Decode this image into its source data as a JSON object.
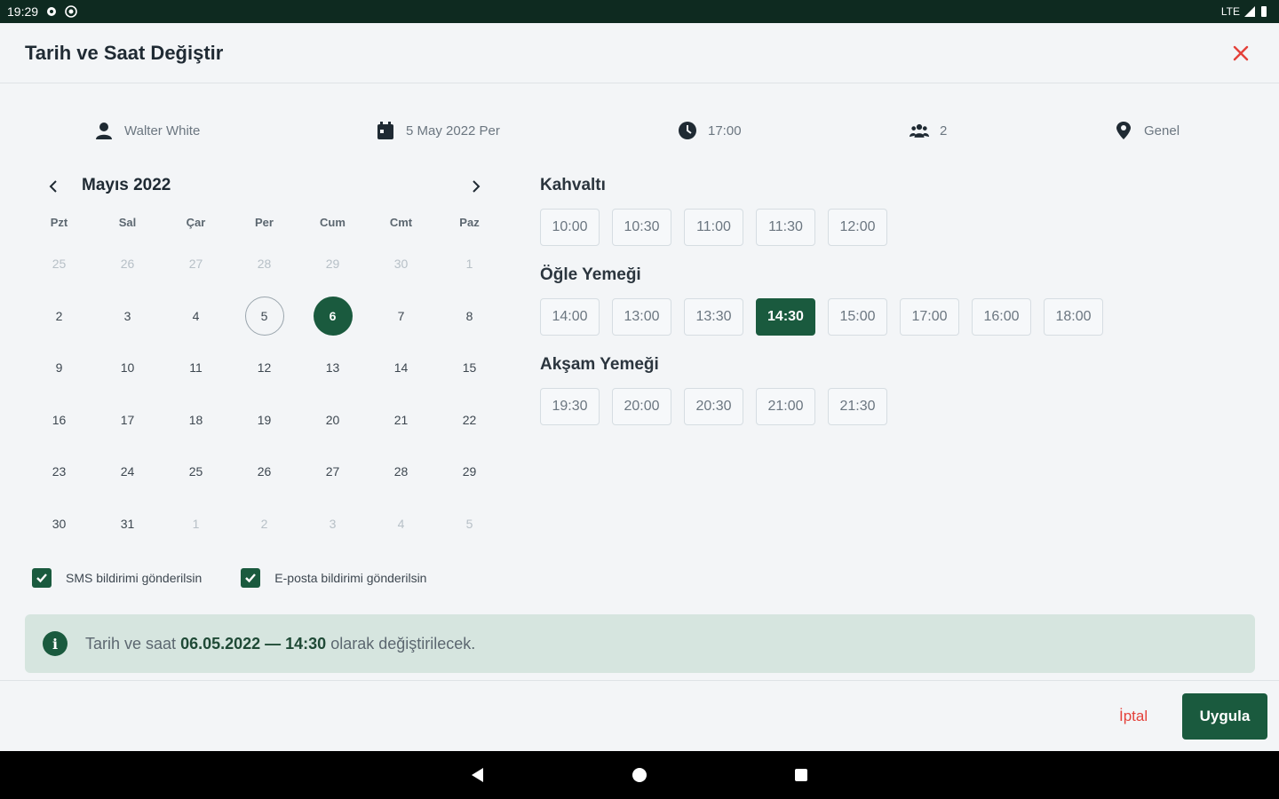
{
  "status_bar": {
    "time": "19:29",
    "network": "LTE"
  },
  "header": {
    "title": "Tarih ve Saat Değiştir"
  },
  "info": {
    "guest_name": "Walter White",
    "date": "5 May 2022 Per",
    "time": "17:00",
    "party_size": "2",
    "area": "Genel"
  },
  "calendar": {
    "month_label": "Mayıs 2022",
    "weekdays": [
      "Pzt",
      "Sal",
      "Çar",
      "Per",
      "Cum",
      "Cmt",
      "Paz"
    ],
    "days": [
      {
        "label": "25",
        "muted": true
      },
      {
        "label": "26",
        "muted": true
      },
      {
        "label": "27",
        "muted": true
      },
      {
        "label": "28",
        "muted": true
      },
      {
        "label": "29",
        "muted": true
      },
      {
        "label": "30",
        "muted": true
      },
      {
        "label": "1",
        "muted": true
      },
      {
        "label": "2"
      },
      {
        "label": "3"
      },
      {
        "label": "4"
      },
      {
        "label": "5",
        "today": true
      },
      {
        "label": "6",
        "selected": true
      },
      {
        "label": "7"
      },
      {
        "label": "8"
      },
      {
        "label": "9"
      },
      {
        "label": "10"
      },
      {
        "label": "11"
      },
      {
        "label": "12"
      },
      {
        "label": "13"
      },
      {
        "label": "14"
      },
      {
        "label": "15"
      },
      {
        "label": "16"
      },
      {
        "label": "17"
      },
      {
        "label": "18"
      },
      {
        "label": "19"
      },
      {
        "label": "20"
      },
      {
        "label": "21"
      },
      {
        "label": "22"
      },
      {
        "label": "23"
      },
      {
        "label": "24"
      },
      {
        "label": "25"
      },
      {
        "label": "26"
      },
      {
        "label": "27"
      },
      {
        "label": "28"
      },
      {
        "label": "29"
      },
      {
        "label": "30"
      },
      {
        "label": "31"
      },
      {
        "label": "1",
        "muted": true
      },
      {
        "label": "2",
        "muted": true
      },
      {
        "label": "3",
        "muted": true
      },
      {
        "label": "4",
        "muted": true
      },
      {
        "label": "5",
        "muted": true
      }
    ]
  },
  "slot_groups": [
    {
      "title": "Kahvaltı",
      "slots": [
        "10:00",
        "10:30",
        "11:00",
        "11:30",
        "12:00"
      ]
    },
    {
      "title": "Öğle Yemeği",
      "slots": [
        "14:00",
        "13:00",
        "13:30",
        "14:30",
        "15:00",
        "17:00",
        "16:00",
        "18:00"
      ],
      "active_index": 3
    },
    {
      "title": "Akşam Yemeği",
      "slots": [
        "19:30",
        "20:00",
        "20:30",
        "21:00",
        "21:30"
      ]
    }
  ],
  "checks": {
    "sms": "SMS bildirimi gönderilsin",
    "email": "E-posta bildirimi gönderilsin"
  },
  "banner": {
    "prefix": "Tarih ve saat ",
    "highlight": "06.05.2022 — 14:30",
    "suffix": " olarak değiştirilecek."
  },
  "footer": {
    "cancel_label": "İptal",
    "apply_label": "Uygula"
  },
  "colors": {
    "primary": "#1a5a3e",
    "danger": "#e4413a",
    "banner_bg": "#d6e5df"
  }
}
